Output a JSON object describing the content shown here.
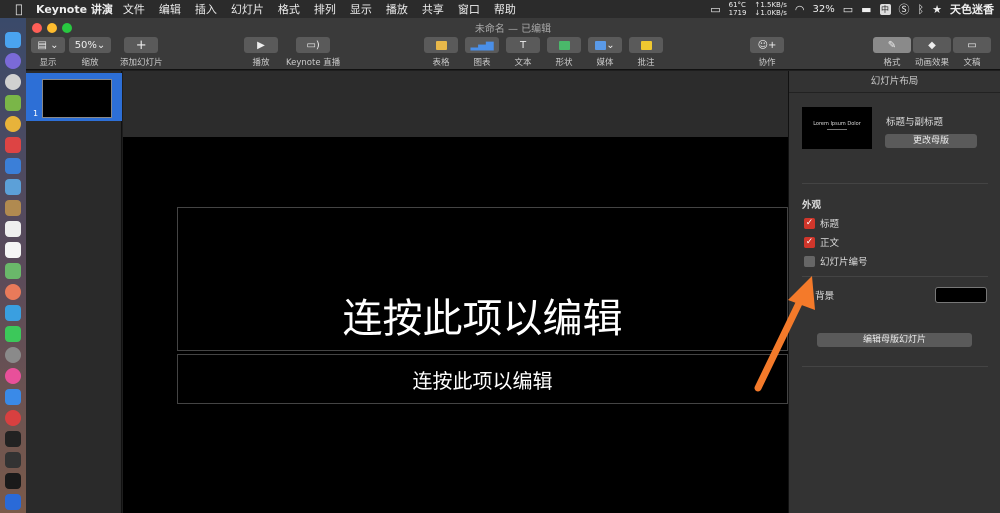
{
  "menubar": {
    "apple_icon": "",
    "app_name": "Keynote 讲演",
    "items": [
      "文件",
      "编辑",
      "插入",
      "幻灯片",
      "格式",
      "排列",
      "显示",
      "播放",
      "共享",
      "窗口",
      "帮助"
    ],
    "status": {
      "temp_top": "61°C",
      "temp_bottom": "1719",
      "net_up": "↑1.5KB/s",
      "net_down": "↓1.0KB/s",
      "battery": "32%",
      "input_method": "中",
      "user": "天色迷香"
    }
  },
  "window": {
    "title": "未命名 — 已编辑",
    "traffic_colors": [
      "#ff5f57",
      "#febc2e",
      "#28c840"
    ]
  },
  "toolbar": {
    "view_label": "显示",
    "zoom_value": "50%",
    "zoom_label": "缩放",
    "add_slide_label": "添加幻灯片",
    "play_label": "播放",
    "live_label": "Keynote 直播",
    "table_label": "表格",
    "chart_label": "图表",
    "text_label": "文本",
    "text_icon": "T",
    "shape_label": "形状",
    "media_label": "媒体",
    "comment_label": "批注",
    "collab_label": "协作",
    "format_label": "格式",
    "animate_label": "动画效果",
    "document_label": "文稿"
  },
  "navigator": {
    "slide_number": "1"
  },
  "slide": {
    "title_placeholder": "连按此项以编辑",
    "subtitle_placeholder": "连按此项以编辑"
  },
  "inspector": {
    "header": "幻灯片布局",
    "layout_thumb_text": "Lorem Ipsum Dolor",
    "layout_name": "标题与副标题",
    "change_master_label": "更改母版",
    "appearance_label": "外观",
    "checkboxes": [
      {
        "label": "标题",
        "checked": true
      },
      {
        "label": "正文",
        "checked": true
      },
      {
        "label": "幻灯片编号",
        "checked": false
      }
    ],
    "background_label": "背景",
    "background_color": "#000000",
    "edit_master_label": "编辑母版幻灯片"
  },
  "colors": {
    "accent_selection": "#2d6fd6",
    "checkbox_on": "#d0362b",
    "annotation_arrow": "#f47a2a"
  }
}
